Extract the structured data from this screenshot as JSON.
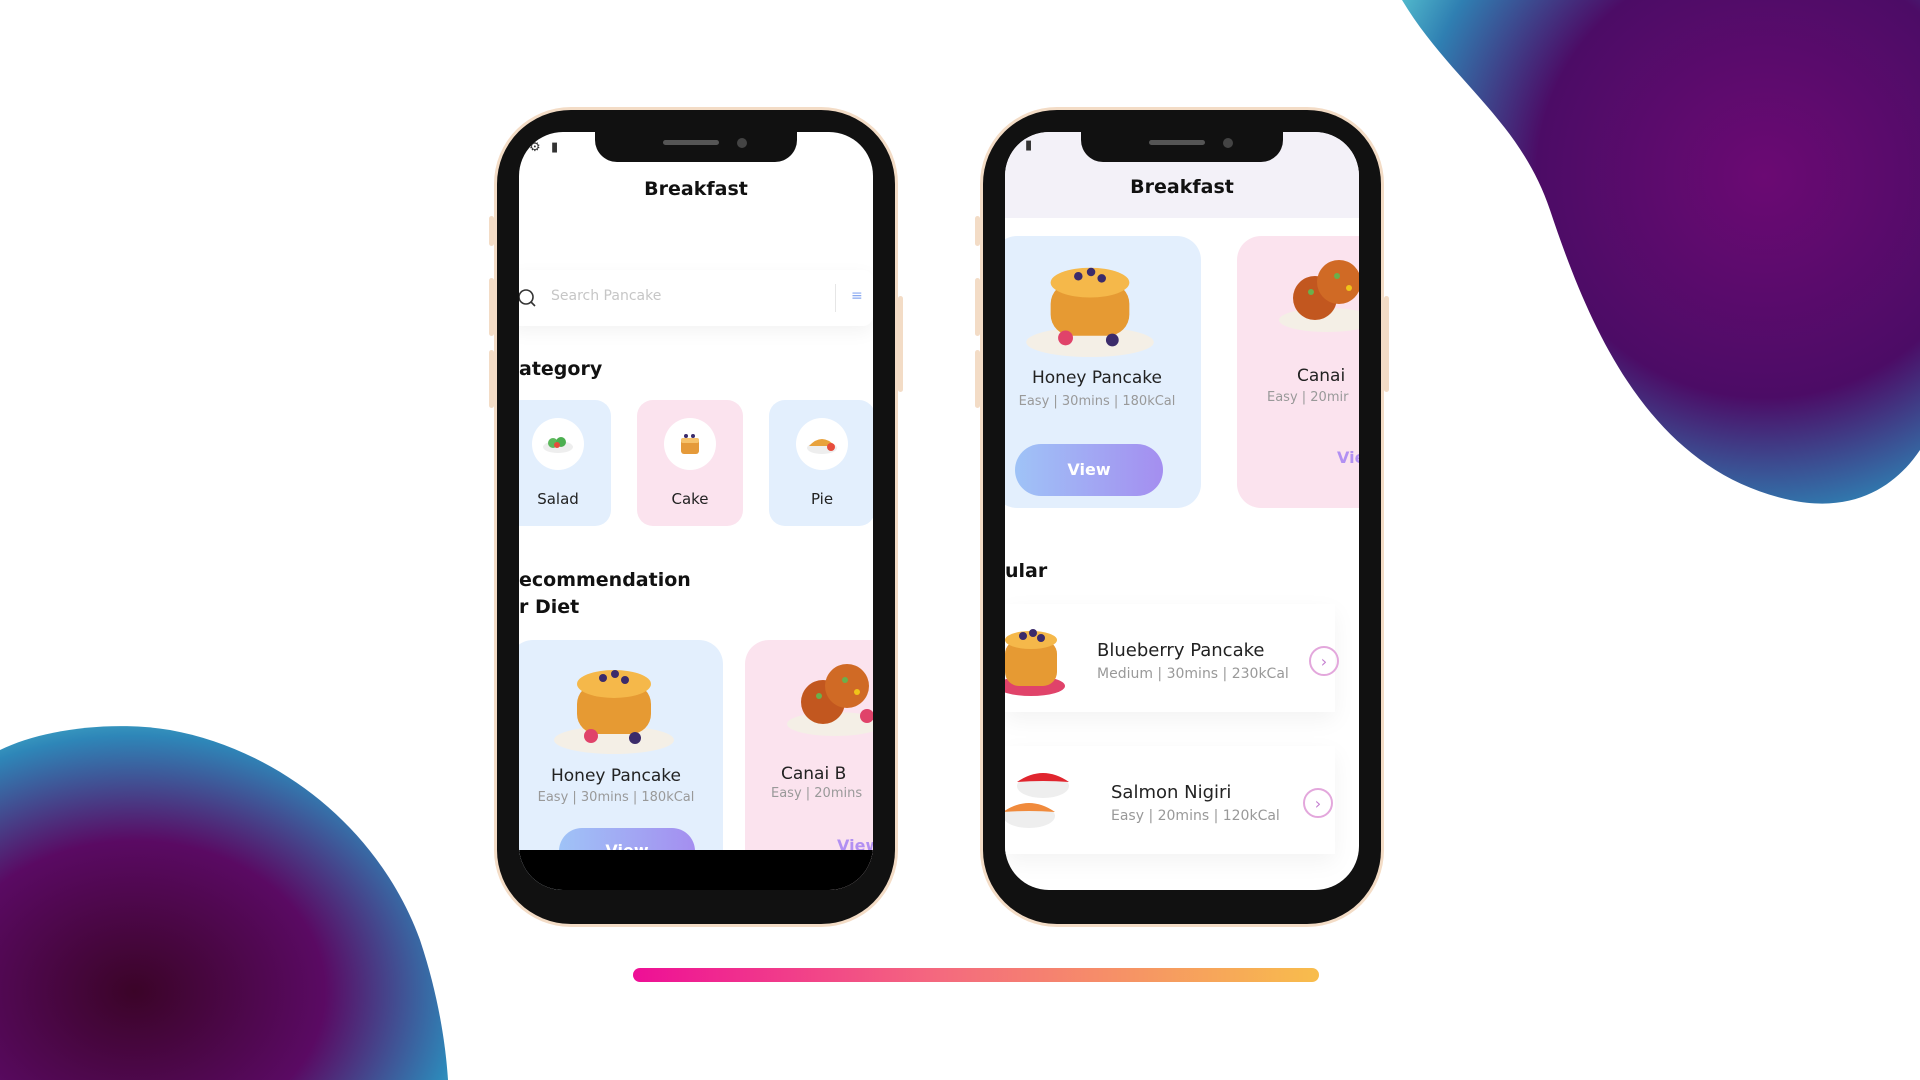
{
  "colors": {
    "accent_gradient": [
      "#ee0f96",
      "#f8bd4c"
    ],
    "blob_gradient": [
      "#5a0a63",
      "#41b6c9"
    ],
    "card_blue": "#e3effd",
    "card_pink": "#fbe3ee",
    "button_gradient": [
      "#9fc3f7",
      "#a48ef0"
    ]
  },
  "phone_left": {
    "status_icons": [
      "gear-icon",
      "sim-card-icon"
    ],
    "title": "Breakfast",
    "search": {
      "placeholder": "Search Pancake"
    },
    "category_title": "ategory",
    "categories": [
      {
        "label": "Salad",
        "icon": "salad-icon"
      },
      {
        "label": "Cake",
        "icon": "cake-icon"
      },
      {
        "label": "Pie",
        "icon": "pie-icon"
      }
    ],
    "recommendation_title_line1": "ecommendation",
    "recommendation_title_line2": "r Diet",
    "recommendations": [
      {
        "name": "Honey Pancake",
        "meta": "Easy | 30mins | 180kCal",
        "button": "View"
      },
      {
        "name": "Canai B",
        "meta": "Easy | 20mins",
        "button": "View"
      }
    ]
  },
  "phone_right": {
    "status_icons": [
      "sim-card-icon"
    ],
    "title": "Breakfast",
    "recommendations": [
      {
        "name": "Honey Pancake",
        "meta": "Easy | 30mins | 180kCal",
        "button": "View"
      },
      {
        "name": "Canai",
        "meta": "Easy | 20mir",
        "button": "Vie"
      }
    ],
    "popular_title": "ular",
    "popular": [
      {
        "name": "Blueberry Pancake",
        "meta": "Medium | 30mins | 230kCal",
        "icon": "chevron-right-icon"
      },
      {
        "name": "Salmon Nigiri",
        "meta": "Easy | 20mins | 120kCal",
        "icon": "chevron-right-icon"
      }
    ]
  }
}
